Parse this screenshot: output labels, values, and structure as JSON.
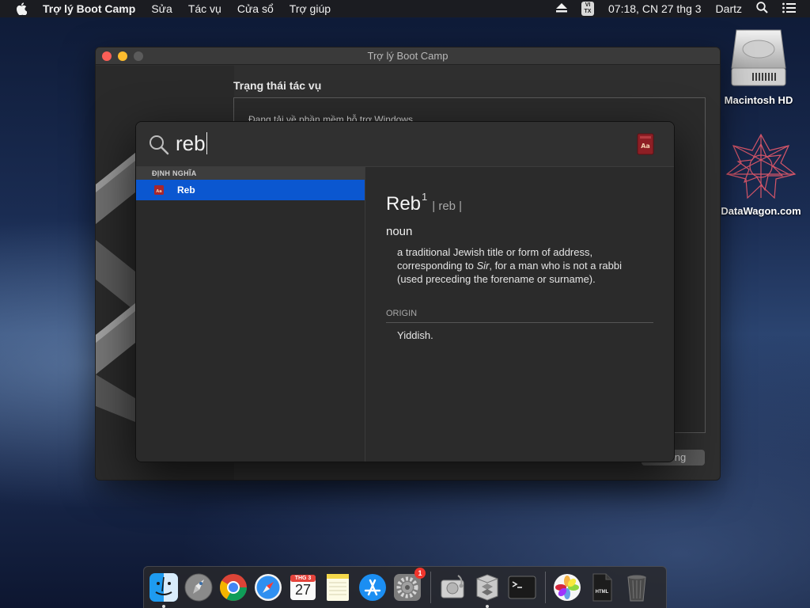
{
  "menubar": {
    "app_name": "Trợ lý Boot Camp",
    "menus": [
      "Sửa",
      "Tác vụ",
      "Cửa sổ",
      "Trợ giúp"
    ],
    "input_source": {
      "line1": "VI",
      "line2": "TX"
    },
    "clock": "07:18, CN 27 thg 3",
    "user": "Dartz"
  },
  "bootcamp_window": {
    "title": "Trợ lý Boot Camp",
    "heading": "Trạng thái tác vụ",
    "status_text": "Đang tải về phần mềm hỗ trợ Windows...",
    "button_label": "Dừng"
  },
  "spotlight": {
    "query": "reb",
    "section_header": "ĐỊNH NGHĨA",
    "results": [
      {
        "label": "Reb",
        "icon": "dictionary-icon",
        "selected": true
      }
    ],
    "definition": {
      "word": "Reb",
      "superscript": "1",
      "pronunciation": "| reb |",
      "part_of_speech": "noun",
      "text_before_italic": "a traditional Jewish title or form of address, corresponding to ",
      "italic": "Sir",
      "text_after_italic": ", for a man who is not a rabbi (used preceding the forename or surname).",
      "origin_label": "ORIGIN",
      "origin_text": "Yiddish."
    }
  },
  "desktop": {
    "icons": [
      {
        "label": "Macintosh HD",
        "icon": "hard-drive-icon"
      },
      {
        "label": "DataWagon.com",
        "icon": "datawagon-logo-icon"
      }
    ]
  },
  "dock": {
    "items": [
      {
        "name": "finder",
        "running": true
      },
      {
        "name": "launchpad",
        "running": false
      },
      {
        "name": "chrome",
        "running": false
      },
      {
        "name": "safari",
        "running": false
      },
      {
        "name": "calendar",
        "month": "THG 3",
        "day": "27",
        "running": false
      },
      {
        "name": "notes",
        "running": false
      },
      {
        "name": "app-store",
        "running": false
      },
      {
        "name": "system-preferences",
        "badge": "1",
        "running": false
      },
      {
        "name": "disk-utility",
        "running": false
      },
      {
        "name": "boot-camp-assistant",
        "running": true
      },
      {
        "name": "terminal",
        "running": false
      },
      {
        "name": "photos",
        "running": false
      },
      {
        "name": "html-file",
        "label": "HTML",
        "running": false
      },
      {
        "name": "trash",
        "running": false
      }
    ]
  },
  "colors": {
    "selection_blue": "#0b57d0",
    "close_red": "#fc5f57",
    "minimize_yellow": "#fdbc2e"
  }
}
